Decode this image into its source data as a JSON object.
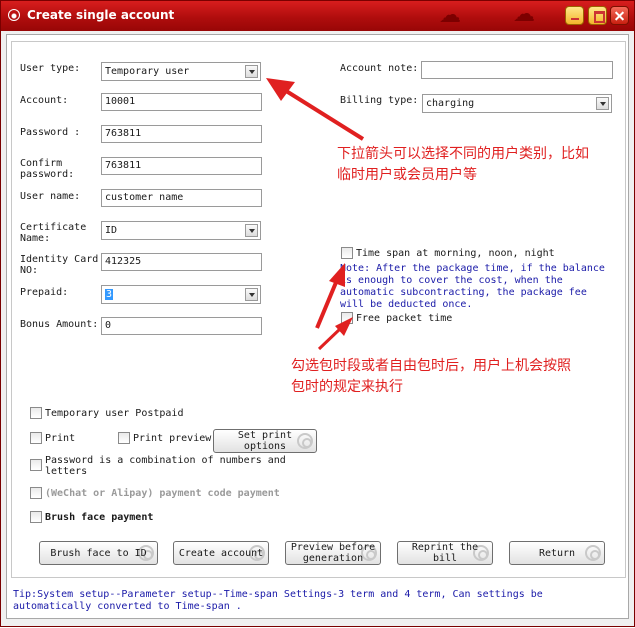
{
  "window": {
    "title": "Create single account",
    "buttons": [
      "minimize",
      "maximize",
      "close"
    ]
  },
  "form_left": {
    "user_type": {
      "label": "User type:",
      "value": "Temporary user"
    },
    "account": {
      "label": "Account:",
      "value": "10001"
    },
    "password": {
      "label": "Password :",
      "value": "763811"
    },
    "confirm_password": {
      "label": "Confirm password:",
      "value": "763811"
    },
    "user_name": {
      "label": "User name:",
      "value": "customer name"
    },
    "certificate_name": {
      "label": "Certificate Name:",
      "value": "ID"
    },
    "identity_card_no": {
      "label": "Identity Card NO:",
      "value": "412325"
    },
    "prepaid": {
      "label": "Prepaid:",
      "value": "3"
    },
    "bonus_amount": {
      "label": "Bonus Amount:",
      "value": "0"
    }
  },
  "form_right": {
    "account_note": {
      "label": "Account note:",
      "value": ""
    },
    "billing_type": {
      "label": "Billing type:",
      "value": "charging"
    },
    "time_span_option": "Time span at morning, noon, night",
    "note": "Note: After the package time, if the balance is enough to cover the cost, when the automatic subcontracting, the package fee will be deducted once.",
    "free_packet_time": "Free packet time"
  },
  "annotations": {
    "dropdown_tip": [
      "下拉箭头可以选择不同的用户类别，比如",
      "临时用户或会员用户等"
    ],
    "checkbox_tip": [
      "勾选包时段或者自由包时后，用户上机会按照",
      "包时的规定来执行"
    ]
  },
  "options": {
    "temporary_postpaid": "Temporary user Postpaid",
    "print": "Print",
    "print_preview": "Print preview",
    "set_print_options": "Set print options",
    "password_combination": "Password is a combination of numbers and letters",
    "wechat_alipay": "(WeChat or Alipay) payment code payment",
    "brush_face_payment": "Brush face payment"
  },
  "actions": {
    "brush_face_to_id": "Brush face to ID",
    "create_account": "Create account",
    "preview_before_generation": "Preview before generation",
    "reprint_the_bill": "Reprint the bill",
    "return": "Return"
  },
  "tip": "Tip:System setup--Parameter setup--Time-span Settings-3 term and 4 term, Can settings be automatically converted to Time-span ."
}
